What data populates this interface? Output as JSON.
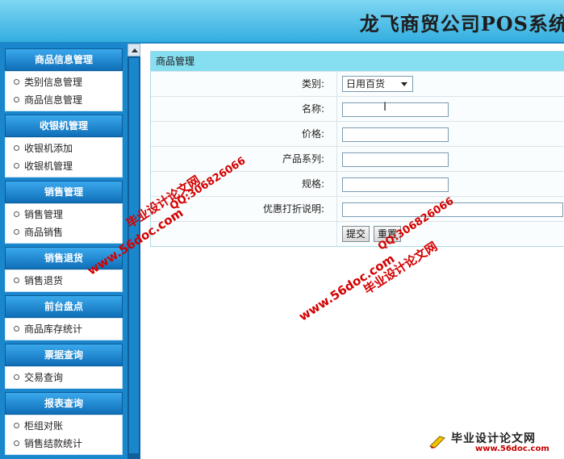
{
  "header": {
    "title": "龙飞商贸公司POS系统"
  },
  "sidebar": {
    "groups": [
      {
        "title": "商品信息管理",
        "items": [
          "类别信息管理",
          "商品信息管理"
        ]
      },
      {
        "title": "收银机管理",
        "items": [
          "收银机添加",
          "收银机管理"
        ]
      },
      {
        "title": "销售管理",
        "items": [
          "销售管理",
          "商品销售"
        ]
      },
      {
        "title": "销售退货",
        "items": [
          "销售退货"
        ]
      },
      {
        "title": "前台盘点",
        "items": [
          "商品库存统计"
        ]
      },
      {
        "title": "票据查询",
        "items": [
          "交易查询"
        ]
      },
      {
        "title": "报表查询",
        "items": [
          "柜组对账",
          "销售结款统计"
        ]
      }
    ]
  },
  "panel": {
    "title": "商品管理",
    "fields": {
      "category_label": "类别:",
      "category_value": "日用百货",
      "name_label": "名称:",
      "price_label": "价格:",
      "series_label": "产品系列:",
      "spec_label": "规格:",
      "discount_label": "优惠打折说明:"
    },
    "submit_label": "提交",
    "reset_label": "重置"
  },
  "watermarks": {
    "url": "www.56doc.com",
    "site": "毕业设计论文网",
    "qq": "QQ:306826066"
  },
  "logo": {
    "name": "毕业设计论文网",
    "url": "www.56doc.com"
  },
  "icons": {
    "bullet": "circle-bullet-icon",
    "scroll_up": "scroll-up-arrow-icon",
    "dropdown": "chevron-down-icon",
    "cursor": "text-cursor-icon"
  }
}
